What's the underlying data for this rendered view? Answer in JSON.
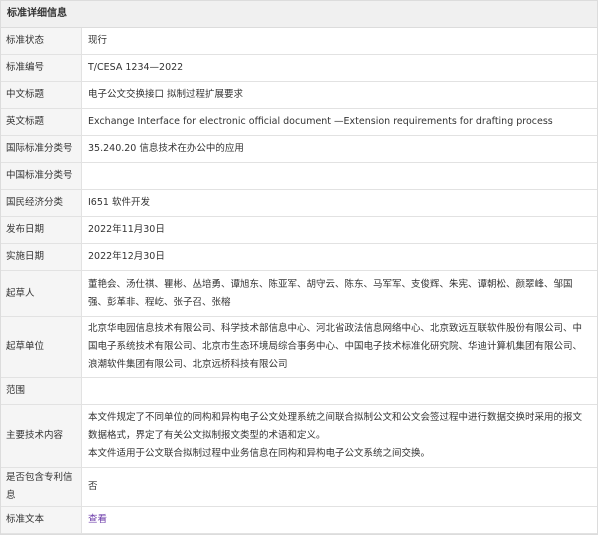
{
  "section_title": "标准详细信息",
  "rows": [
    {
      "label": "标准状态",
      "value": "现行"
    },
    {
      "label": "标准编号",
      "value": "T/CESA 1234—2022"
    },
    {
      "label": "中文标题",
      "value": "电子公文交换接口 拟制过程扩展要求"
    },
    {
      "label": "英文标题",
      "value": "Exchange Interface for electronic official document —Extension requirements for drafting process"
    },
    {
      "label": "国际标准分类号",
      "value": "35.240.20 信息技术在办公中的应用"
    },
    {
      "label": "中国标准分类号",
      "value": ""
    },
    {
      "label": "国民经济分类",
      "value": "I651 软件开发"
    },
    {
      "label": "发布日期",
      "value": "2022年11月30日"
    },
    {
      "label": "实施日期",
      "value": "2022年12月30日"
    },
    {
      "label": "起草人",
      "value": "董艳会、汤仕祺、瞿彬、丛培勇、谭旭东、陈亚军、胡守云、陈东、马军军、支俊辉、朱宪、谭朝松、颜翠峰、邹国强、彭革非、程屹、张子召、张榕"
    },
    {
      "label": "起草单位",
      "value": "北京华电园信息技术有限公司、科学技术部信息中心、河北省政法信息网络中心、北京致远互联软件股份有限公司、中国电子系统技术有限公司、北京市生态环境局综合事务中心、中国电子技术标准化研究院、华迪计算机集团有限公司、浪潮软件集团有限公司、北京远桥科技有限公司"
    },
    {
      "label": "范围",
      "value": ""
    },
    {
      "label": "主要技术内容",
      "value": "本文件规定了不同单位的同构和异构电子公文处理系统之间联合拟制公文和公文会签过程中进行数据交换时采用的报文数据格式，界定了有关公文拟制报文类型的术语和定义。",
      "value2": "本文件适用于公文联合拟制过程中业务信息在同构和异构电子公文系统之间交换。"
    },
    {
      "label": "是否包含专利信息",
      "value": "否"
    },
    {
      "label": "标准文本",
      "value": "查看"
    }
  ]
}
